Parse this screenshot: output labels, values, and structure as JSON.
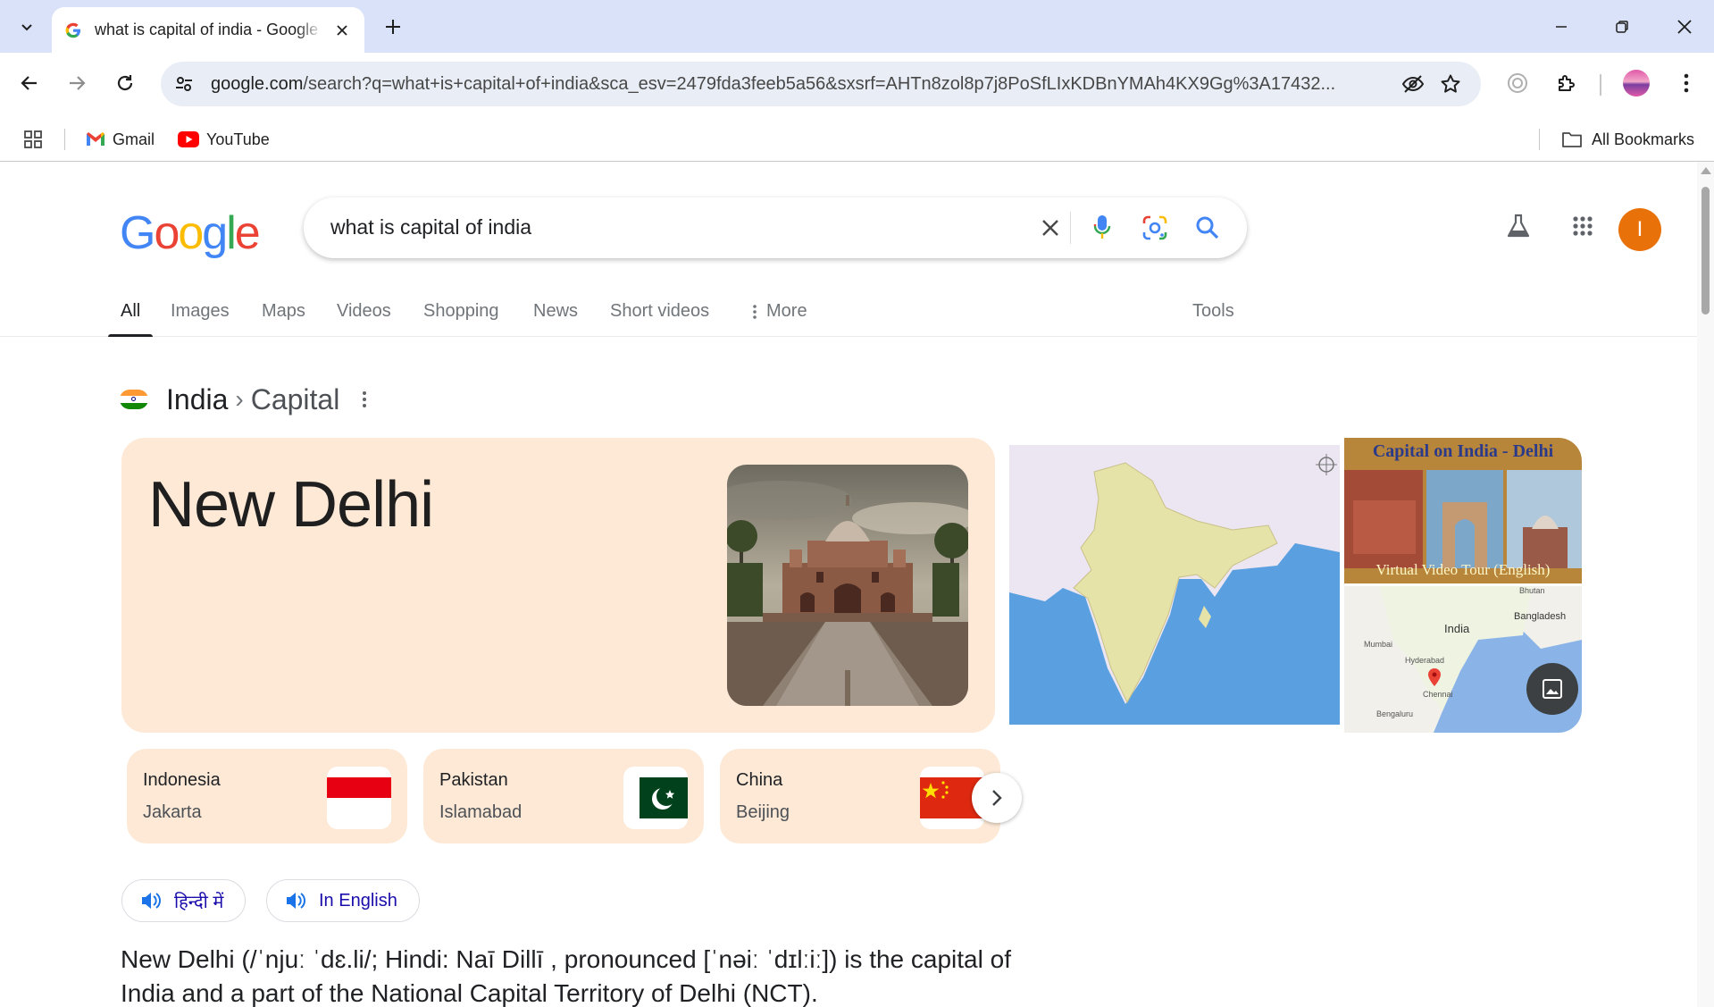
{
  "browser": {
    "tab_title": "what is capital of india - Google Search",
    "url_host": "google.com",
    "url_path": "/search?q=what+is+capital+of+india&sca_esv=2479fda3feeb5a56&sxsrf=AHTn8zol8p7j8PoSfLIxKDBnYMAh4KX9Gg%3A17432...",
    "bookmarks": [
      {
        "label": "Gmail",
        "icon": "gmail-icon"
      },
      {
        "label": "YouTube",
        "icon": "youtube-icon"
      }
    ],
    "all_bookmarks_label": "All Bookmarks"
  },
  "search": {
    "logo": "Google",
    "query": "what is capital of india",
    "avatar_letter": "I"
  },
  "nav": {
    "tabs": [
      "All",
      "Images",
      "Maps",
      "Videos",
      "Shopping",
      "News",
      "Short videos",
      "More"
    ],
    "active": "All",
    "tools": "Tools"
  },
  "panel": {
    "breadcrumb_main": "India",
    "breadcrumb_sep": "›",
    "breadcrumb_sub": "Capital",
    "answer": "New Delhi",
    "tour_caption_top": "Capital on India - Delhi",
    "tour_caption_bottom": "Virtual Video Tour (English)",
    "map2_labels": [
      "India",
      "Bangladesh",
      "Bhutan",
      "Mumbai",
      "Hyderabad",
      "Chennai",
      "Bengaluru"
    ],
    "related": [
      {
        "country": "Indonesia",
        "capital": "Jakarta"
      },
      {
        "country": "Pakistan",
        "capital": "Islamabad"
      },
      {
        "country": "China",
        "capital": "Beijing"
      }
    ],
    "pron_hindi": "हिन्दी में",
    "pron_english": "In English",
    "description": "New Delhi (/ˈnjuː ˈdɛ.li/; Hindi: Naī Dillī , pronounced [ˈnəiː ˈdɪlːiː]) is the capital of India and a part of the National Capital Territory of Delhi (NCT)."
  },
  "colors": {
    "card_bg": "#fde9d6",
    "tab_strip": "#dae2f9",
    "omnibox": "#e9eef6",
    "avatar": "#e8710a",
    "link": "#1a0dab"
  }
}
